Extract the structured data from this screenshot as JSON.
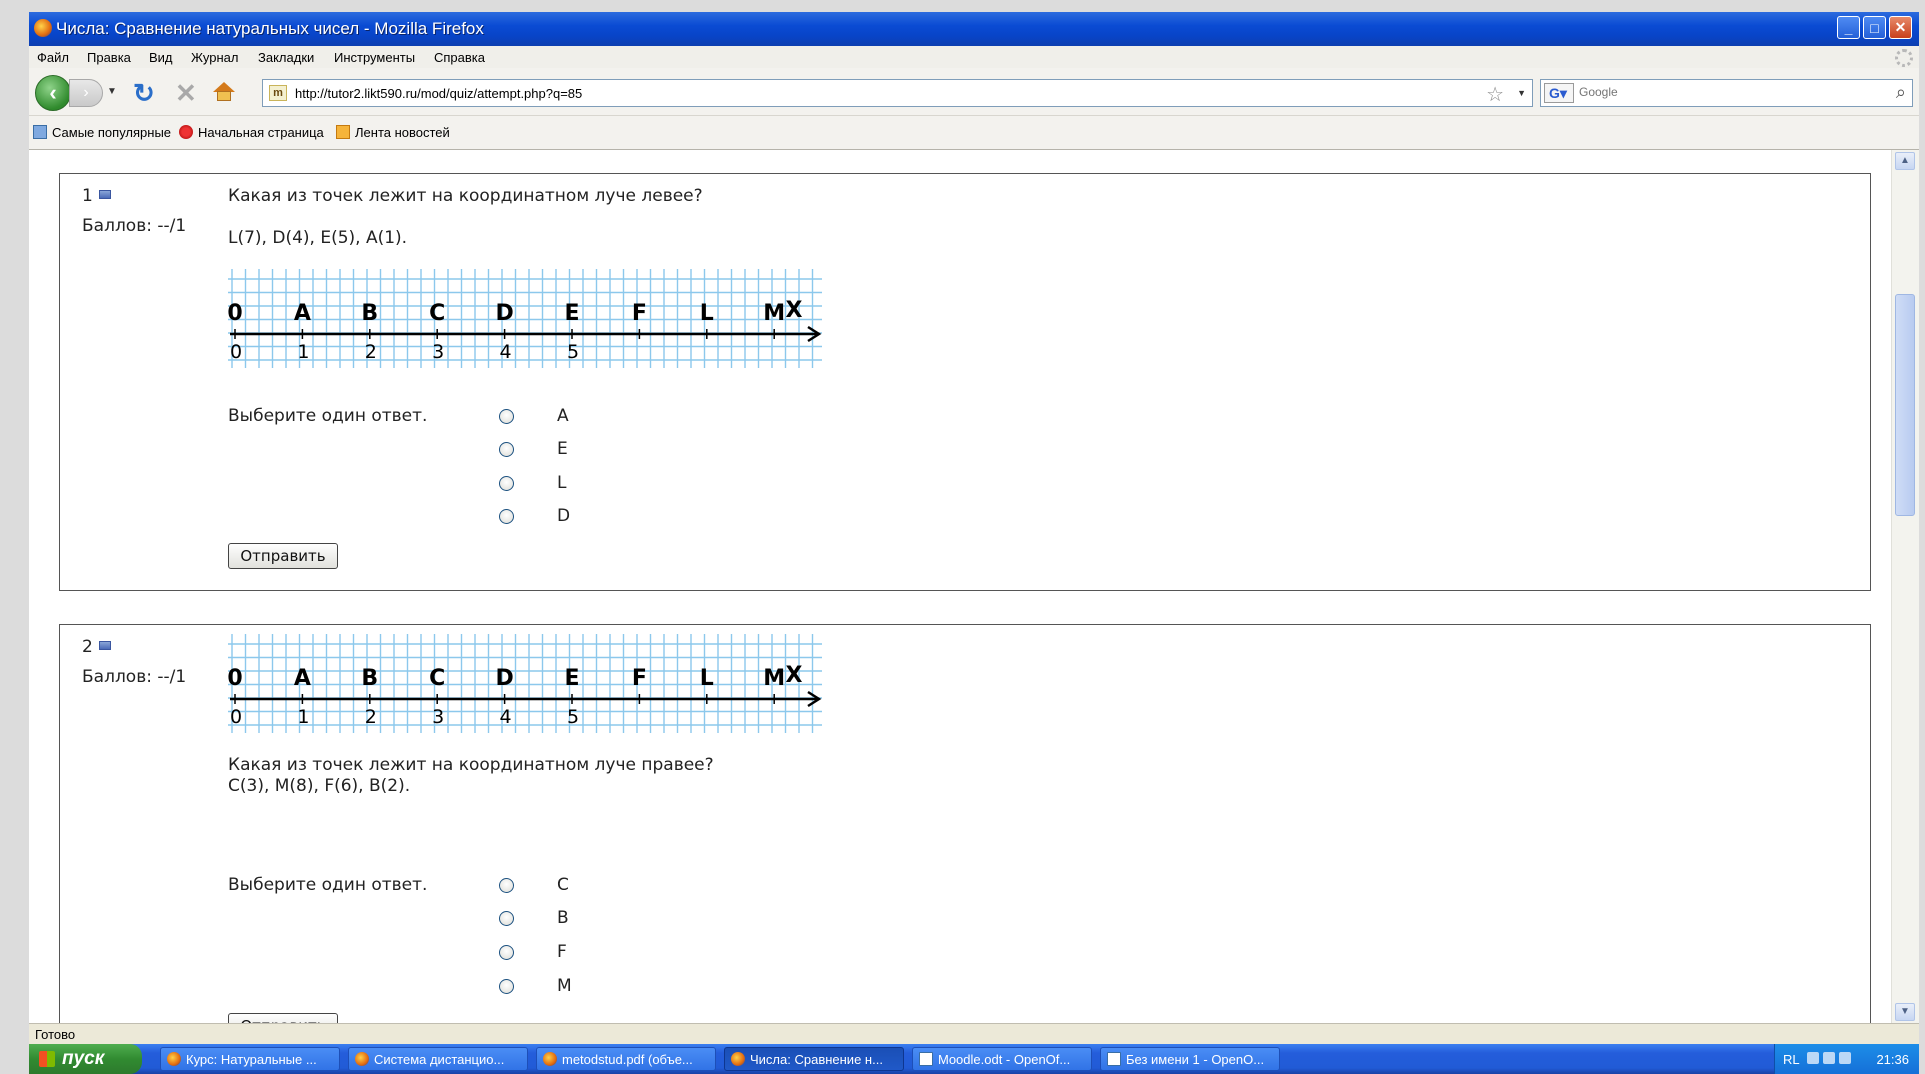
{
  "window": {
    "title": "Числа: Сравнение натуральных чисел - Mozilla Firefox",
    "buttons": {
      "minimize": "_",
      "maximize": "□",
      "close": "✕"
    }
  },
  "menu": [
    "Файл",
    "Правка",
    "Вид",
    "Журнал",
    "Закладки",
    "Инструменты",
    "Справка"
  ],
  "nav": {
    "url": "http://tutor2.likt590.ru/mod/quiz/attempt.php?q=85",
    "site_icon": "m",
    "search_placeholder": "Google",
    "icons": [
      "back-arrow-icon",
      "forward-arrow-icon",
      "reload-icon",
      "stop-icon",
      "home-icon",
      "star-icon",
      "magnifier-icon"
    ]
  },
  "bookmarks": [
    "Самые популярные",
    "Начальная страница",
    "Лента новостей"
  ],
  "numberline": {
    "points": [
      {
        "label": "0",
        "value": 0
      },
      {
        "label": "A",
        "value": 1
      },
      {
        "label": "B",
        "value": 2
      },
      {
        "label": "C",
        "value": 3
      },
      {
        "label": "D",
        "value": 4
      },
      {
        "label": "E",
        "value": 5
      },
      {
        "label": "F",
        "value": 6
      },
      {
        "label": "L",
        "value": 7
      },
      {
        "label": "M",
        "value": 8
      }
    ],
    "tick_labels": [
      "0",
      "1",
      "2",
      "3",
      "4",
      "5"
    ],
    "axis_label": "X"
  },
  "questions": [
    {
      "number": "1",
      "grade": "Баллов: --/1",
      "text_line1": "Какая из точек лежит на координатном луче левее?",
      "text_line2": "L(7), D(4), E(5), A(1).",
      "prompt": "Выберите один ответ.",
      "options": [
        "A",
        "E",
        "L",
        "D"
      ],
      "submit": "Отправить"
    },
    {
      "number": "2",
      "grade": "Баллов: --/1",
      "text_line1": "Какая из точек лежит на координатном луче правее?",
      "text_line2": "C(3), M(8), F(6), B(2).",
      "prompt": "Выберите один ответ.",
      "options": [
        "C",
        "B",
        "F",
        "M"
      ],
      "submit": "Отправить"
    }
  ],
  "status": "Готово",
  "taskbar": {
    "start": "пуск",
    "tasks": [
      "Курс: Натуральные ...",
      "Система дистанцио...",
      "metodstud.pdf (объе...",
      "Числа: Сравнение н...",
      "Moodle.odt - OpenOf...",
      "Без имени 1 - OpenO..."
    ],
    "lang": "RL",
    "time": "21:36"
  }
}
